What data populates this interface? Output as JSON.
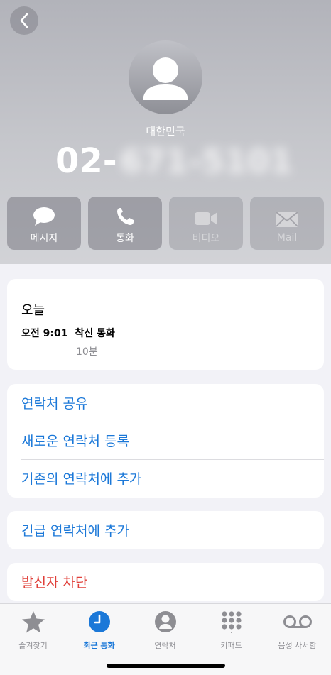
{
  "header": {
    "country": "대한민국",
    "phone_prefix": "02-",
    "phone_obscured": "671-5101"
  },
  "actions": [
    {
      "label": "메시지",
      "icon": "message-bubble-icon",
      "enabled": true
    },
    {
      "label": "통화",
      "icon": "phone-icon",
      "enabled": true
    },
    {
      "label": "비디오",
      "icon": "video-camera-icon",
      "enabled": false
    },
    {
      "label": "Mail",
      "icon": "envelope-icon",
      "enabled": false
    }
  ],
  "recent": {
    "title": "오늘",
    "time": "오전 9:01",
    "type": "착신 통화",
    "duration": "10분"
  },
  "contact_options": [
    {
      "label": "연락처 공유"
    },
    {
      "label": "새로운 연락처 등록"
    },
    {
      "label": "기존의 연락처에 추가"
    }
  ],
  "emergency": {
    "label": "긴급 연락처에 추가"
  },
  "block": {
    "label": "발신자 차단"
  },
  "tabs": [
    {
      "label": "즐겨찾기",
      "icon": "star-icon",
      "active": false
    },
    {
      "label": "최근 통화",
      "icon": "clock-icon",
      "active": true
    },
    {
      "label": "연락처",
      "icon": "person-circle-icon",
      "active": false
    },
    {
      "label": "키패드",
      "icon": "keypad-icon",
      "active": false
    },
    {
      "label": "음성 사서함",
      "icon": "voicemail-icon",
      "active": false
    }
  ],
  "colors": {
    "accent": "#1b78d8",
    "destructive": "#e0403a",
    "inactive_tab": "#8e8e93"
  }
}
